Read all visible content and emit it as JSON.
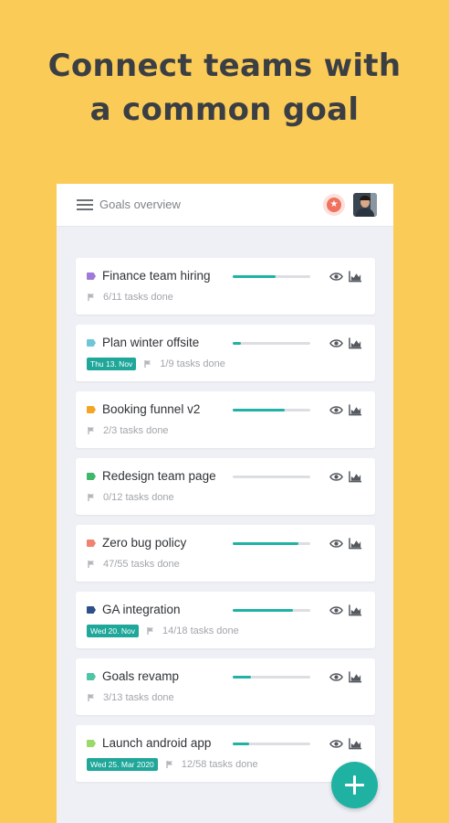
{
  "headline": {
    "line1": "Connect teams with",
    "line2": "a common goal"
  },
  "colors": {
    "background": "#fbcb57",
    "accent": "#20b2a4",
    "heading": "#3b3f44"
  },
  "app_bar": {
    "menu_icon": "hamburger-menu-icon",
    "title": "Goals overview",
    "badge_icon": "star-badge-icon",
    "avatar": "user-avatar"
  },
  "goals": [
    {
      "title": "Finance team hiring",
      "flag_color": "#a07ad8",
      "progress": 0.55,
      "date": "",
      "tasks": "6/11 tasks done"
    },
    {
      "title": "Plan winter offsite",
      "flag_color": "#6ec6d6",
      "progress": 0.11,
      "date": "Thu 13. Nov",
      "tasks": "1/9 tasks done"
    },
    {
      "title": "Booking funnel v2",
      "flag_color": "#f3a623",
      "progress": 0.67,
      "date": "",
      "tasks": "2/3 tasks done"
    },
    {
      "title": "Redesign team page",
      "flag_color": "#3fb86a",
      "progress": 0.0,
      "date": "",
      "tasks": "0/12 tasks done"
    },
    {
      "title": "Zero bug policy",
      "flag_color": "#f08470",
      "progress": 0.85,
      "date": "",
      "tasks": "47/55 tasks done"
    },
    {
      "title": "GA integration",
      "flag_color": "#2f4f8a",
      "progress": 0.78,
      "date": "Wed 20. Nov",
      "tasks": "14/18 tasks done"
    },
    {
      "title": "Goals revamp",
      "flag_color": "#4fc4a6",
      "progress": 0.23,
      "date": "",
      "tasks": "3/13 tasks done"
    },
    {
      "title": "Launch android app",
      "flag_color": "#9ada6a",
      "progress": 0.21,
      "date": "Wed 25. Mar 2020",
      "tasks": "12/58 tasks done"
    }
  ],
  "goal_icons": {
    "view": "eye-icon",
    "stats": "bar-chart-icon",
    "tasks": "flag-tasks-icon"
  },
  "fab": {
    "icon": "plus-icon",
    "color": "#1fb2a3"
  }
}
